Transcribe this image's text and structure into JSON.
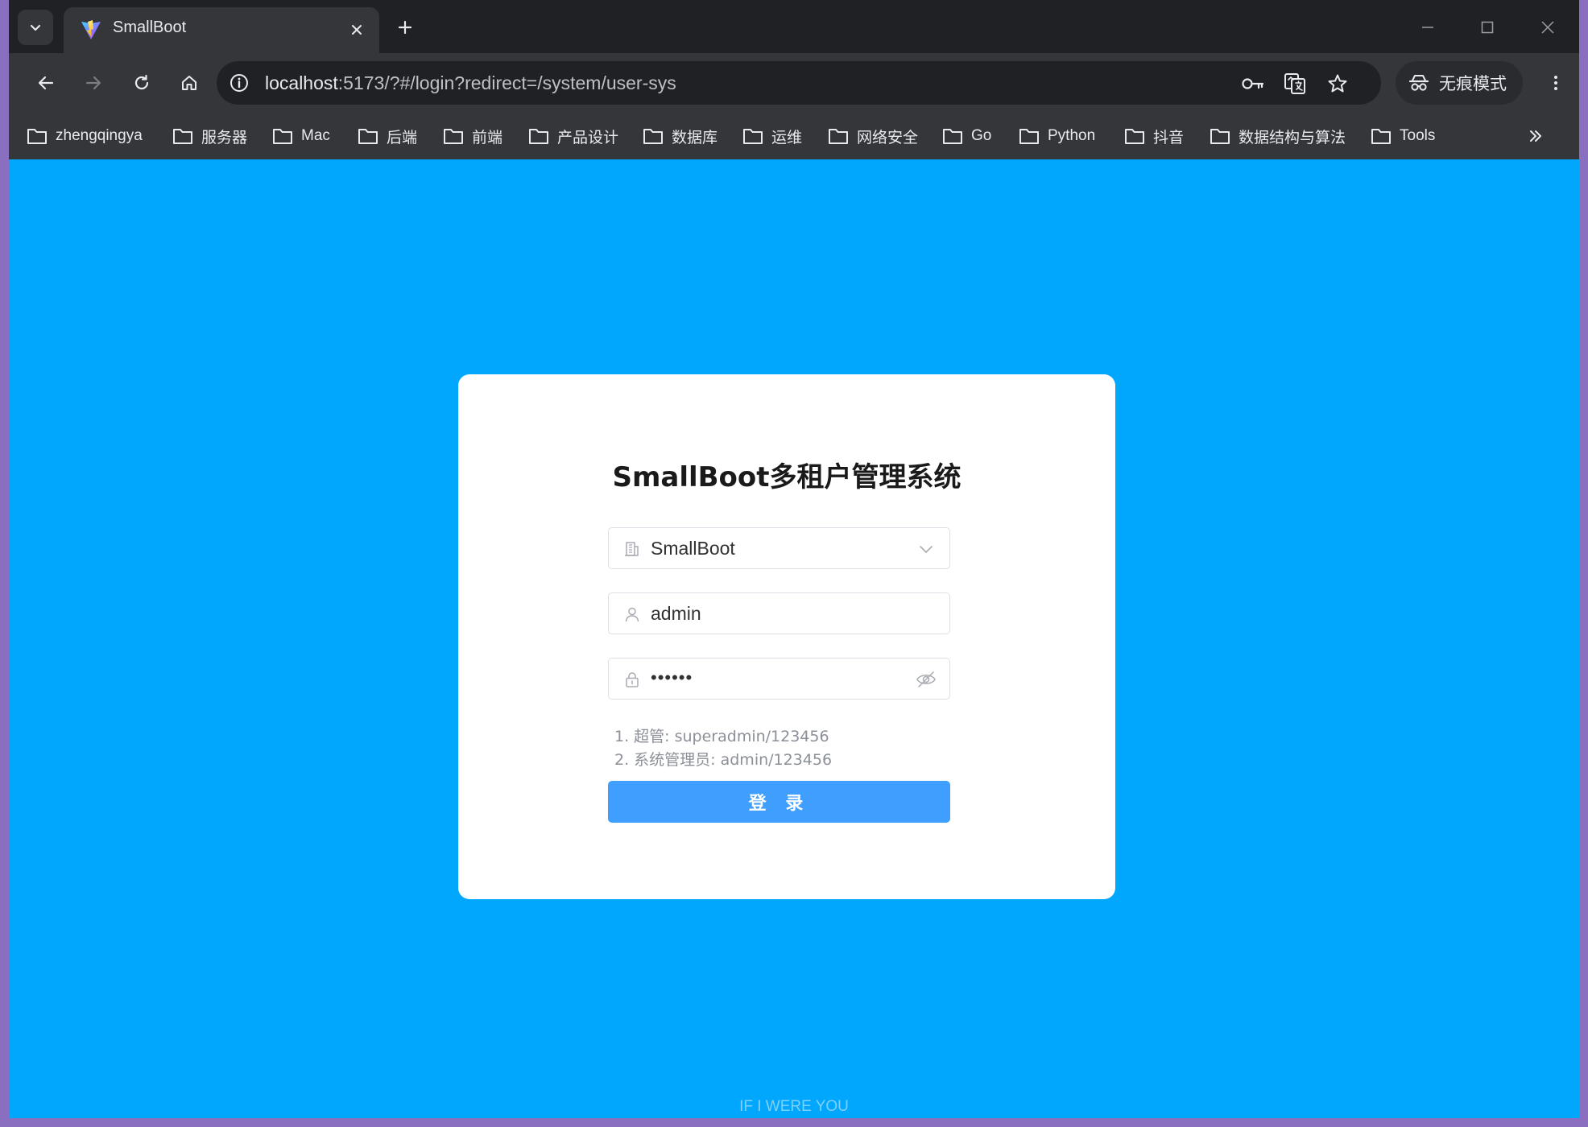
{
  "browser": {
    "tab": {
      "title": "SmallBoot"
    },
    "address": {
      "host": "localhost",
      "path": ":5173/?#/login?redirect=/system/user-sys"
    },
    "incognito_label": "无痕模式",
    "bookmarks": [
      "zhengqingya",
      "服务器",
      "Mac",
      "后端",
      "前端",
      "产品设计",
      "数据库",
      "运维",
      "网络安全",
      "Go",
      "Python",
      "抖音",
      "数据结构与算法",
      "Tools"
    ]
  },
  "login": {
    "title": "SmallBoot多租户管理系统",
    "tenant": "SmallBoot",
    "username": "admin",
    "password_mask": "••••••",
    "hints": [
      "1. 超管: superadmin/123456",
      "2. 系统管理员: admin/123456"
    ],
    "submit_label": "登 录"
  },
  "footer": {
    "text": "IF I WERE YOU"
  },
  "colors": {
    "page_bg": "#00a7fd",
    "primary": "#409eff",
    "browser_chrome": "#35363a"
  }
}
